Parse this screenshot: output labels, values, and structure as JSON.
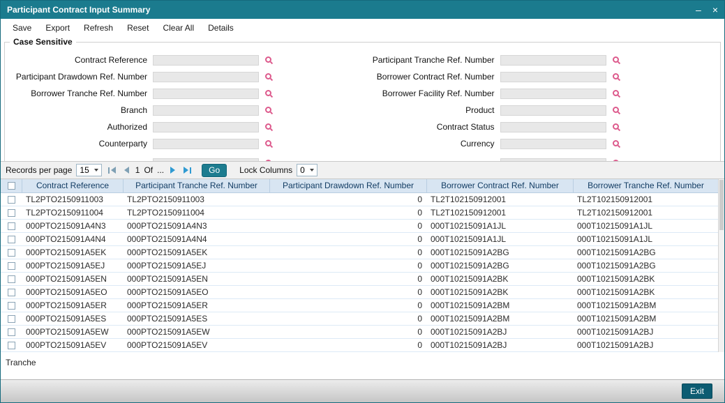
{
  "window": {
    "title": "Participant Contract Input Summary",
    "minimize": "–",
    "close": "×"
  },
  "toolbar": {
    "items": [
      "Save",
      "Export",
      "Refresh",
      "Reset",
      "Clear All",
      "Details"
    ]
  },
  "search": {
    "legend": "Case Sensitive",
    "fields_left": [
      {
        "label": "Contract Reference",
        "value": ""
      },
      {
        "label": "Participant Drawdown Ref. Number",
        "value": ""
      },
      {
        "label": "Borrower Tranche Ref. Number",
        "value": ""
      },
      {
        "label": "Branch",
        "value": ""
      },
      {
        "label": "Authorized",
        "value": ""
      },
      {
        "label": "Counterparty",
        "value": ""
      }
    ],
    "fields_right": [
      {
        "label": "Participant Tranche Ref. Number",
        "value": ""
      },
      {
        "label": "Borrower Contract Ref. Number",
        "value": ""
      },
      {
        "label": "Borrower Facility Ref. Number",
        "value": ""
      },
      {
        "label": "Product",
        "value": ""
      },
      {
        "label": "Contract Status",
        "value": ""
      },
      {
        "label": "Currency",
        "value": ""
      }
    ]
  },
  "pagination": {
    "records_per_page_label": "Records per page",
    "records_per_page_value": "15",
    "page_current": "1",
    "of_label": "Of",
    "page_total": "...",
    "go_label": "Go",
    "lock_columns_label": "Lock Columns",
    "lock_columns_value": "0"
  },
  "table": {
    "columns": [
      "Contract Reference",
      "Participant Tranche Ref. Number",
      "Participant Drawdown Ref. Number",
      "Borrower Contract Ref. Number",
      "Borrower Tranche Ref. Number"
    ],
    "rows": [
      [
        "TL2PTO2150911003",
        "TL2PTO2150911003",
        "0",
        "TL2T102150912001",
        "TL2T102150912001"
      ],
      [
        "TL2PTO2150911004",
        "TL2PTO2150911004",
        "0",
        "TL2T102150912001",
        "TL2T102150912001"
      ],
      [
        "000PTO215091A4N3",
        "000PTO215091A4N3",
        "0",
        "000T10215091A1JL",
        "000T10215091A1JL"
      ],
      [
        "000PTO215091A4N4",
        "000PTO215091A4N4",
        "0",
        "000T10215091A1JL",
        "000T10215091A1JL"
      ],
      [
        "000PTO215091A5EK",
        "000PTO215091A5EK",
        "0",
        "000T10215091A2BG",
        "000T10215091A2BG"
      ],
      [
        "000PTO215091A5EJ",
        "000PTO215091A5EJ",
        "0",
        "000T10215091A2BG",
        "000T10215091A2BG"
      ],
      [
        "000PTO215091A5EN",
        "000PTO215091A5EN",
        "0",
        "000T10215091A2BK",
        "000T10215091A2BK"
      ],
      [
        "000PTO215091A5EO",
        "000PTO215091A5EO",
        "0",
        "000T10215091A2BK",
        "000T10215091A2BK"
      ],
      [
        "000PTO215091A5ER",
        "000PTO215091A5ER",
        "0",
        "000T10215091A2BM",
        "000T10215091A2BM"
      ],
      [
        "000PTO215091A5ES",
        "000PTO215091A5ES",
        "0",
        "000T10215091A2BM",
        "000T10215091A2BM"
      ],
      [
        "000PTO215091A5EW",
        "000PTO215091A5EW",
        "0",
        "000T10215091A2BJ",
        "000T10215091A2BJ"
      ],
      [
        "000PTO215091A5EV",
        "000PTO215091A5EV",
        "0",
        "000T10215091A2BJ",
        "000T10215091A2BJ"
      ]
    ]
  },
  "footer": {
    "tab_label": "Tranche",
    "exit_label": "Exit"
  },
  "icons": {
    "field_lookup": "magnifier",
    "select_arrow": "chevron-down",
    "nav_first": "first-page",
    "nav_previous": "previous-page",
    "nav_next": "next-page",
    "nav_last": "last-page"
  },
  "colors": {
    "titlebar": "#1b7b8e",
    "go_button": "#1d7c8f",
    "exit_button": "#0d5c72",
    "search_icon": "#dd5a8c",
    "table_header_bg": "#d8e5f2"
  }
}
